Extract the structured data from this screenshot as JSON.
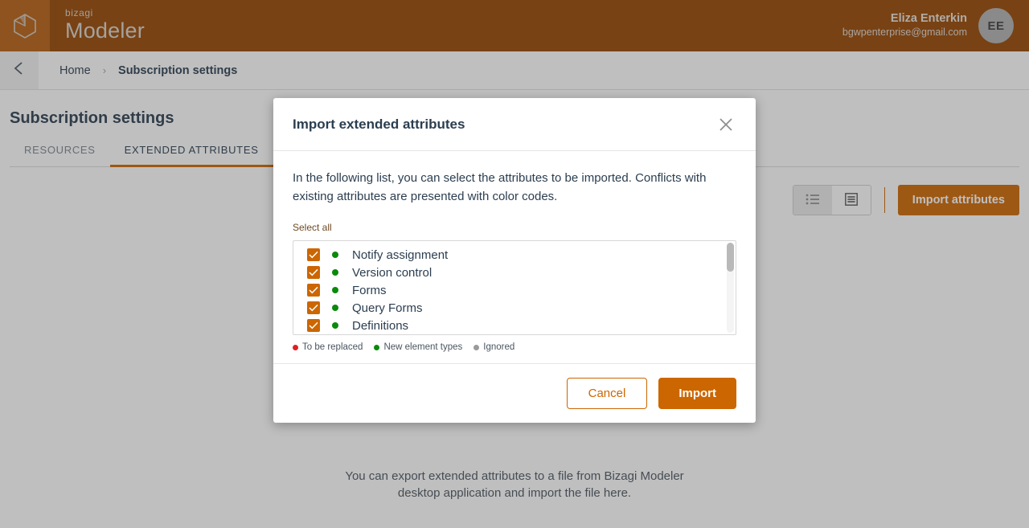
{
  "topbar": {
    "logo_icon": "cube-icon",
    "brand_small": "bizagi",
    "brand_large": "Modeler",
    "user_name": "Eliza Enterkin",
    "user_email": "bgwpenterprise@gmail.com",
    "avatar_initials": "EE"
  },
  "breadcrumb": {
    "back_icon": "chevron-left-icon",
    "home": "Home",
    "separator": "›",
    "current": "Subscription settings"
  },
  "page": {
    "title": "Subscription settings",
    "tabs": [
      {
        "label": "RESOURCES",
        "active": false
      },
      {
        "label": "EXTENDED ATTRIBUTES",
        "active": true
      }
    ],
    "toolbar": {
      "view_list_icon": "list-view-icon",
      "view_grid_icon": "grid-view-icon",
      "import_attributes_label": "Import attributes"
    },
    "empty_note_line1": "You can export extended attributes to a file from Bizagi Modeler",
    "empty_note_line2": "desktop application and import the file here."
  },
  "modal": {
    "title": "Import extended attributes",
    "close_icon": "close-icon",
    "description": "In the following list, you can select the attributes to be imported. Conflicts with existing attributes are presented with color codes.",
    "select_all_label": "Select all",
    "attributes": [
      {
        "label": "Notify assignment",
        "checked": true,
        "status": "new"
      },
      {
        "label": "Version control",
        "checked": true,
        "status": "new"
      },
      {
        "label": "Forms",
        "checked": true,
        "status": "new"
      },
      {
        "label": "Query Forms",
        "checked": true,
        "status": "new"
      },
      {
        "label": "Definitions",
        "checked": true,
        "status": "new"
      }
    ],
    "legend": [
      {
        "label": "To be replaced",
        "color": "#e02020"
      },
      {
        "label": "New element types",
        "color": "#0a8a0a"
      },
      {
        "label": "Ignored",
        "color": "#9a9a9a"
      }
    ],
    "cancel_label": "Cancel",
    "import_label": "Import"
  },
  "colors": {
    "brand_orange": "#cc6600",
    "header_brown": "#964500",
    "logo_tile": "#b75f11",
    "text_dark": "#2b3e50",
    "status_new": "#0a8a0a",
    "status_replace": "#e02020",
    "status_ignored": "#9a9a9a"
  }
}
